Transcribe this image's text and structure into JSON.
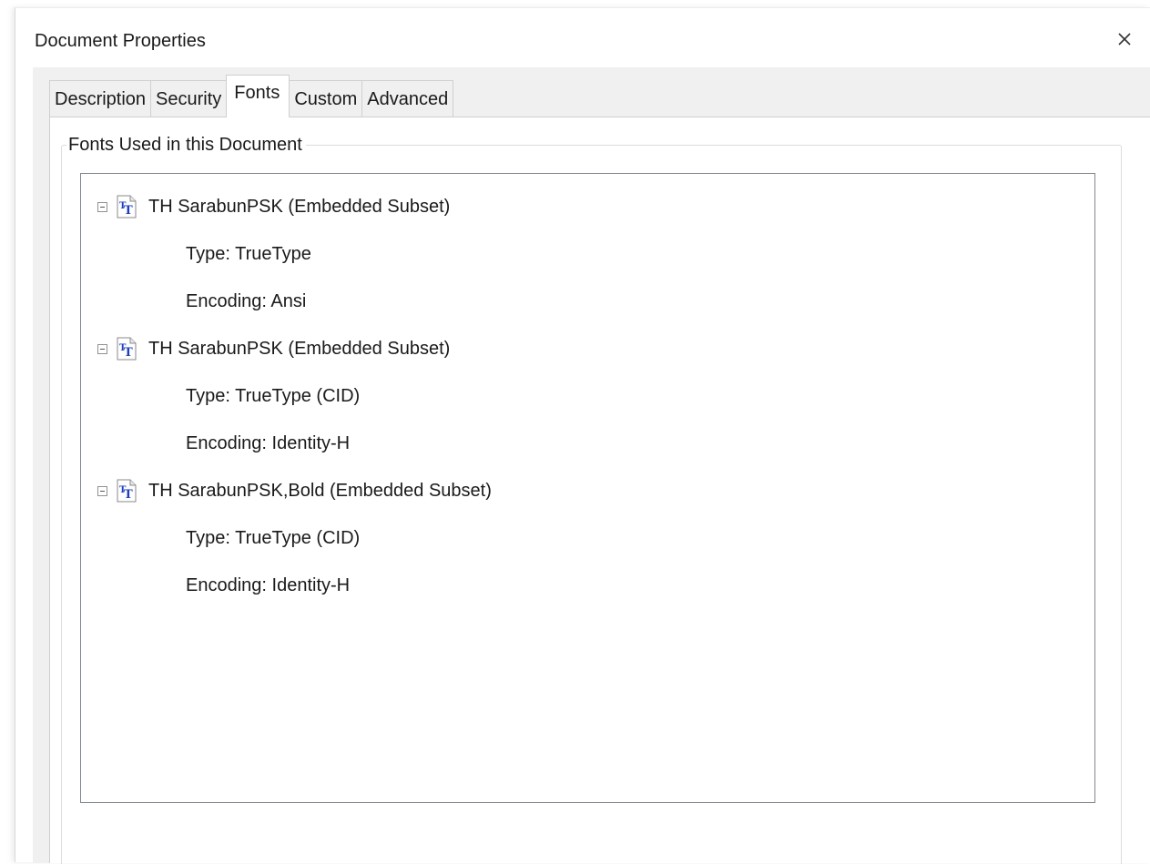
{
  "window": {
    "title": "Document Properties",
    "close_symbol": "×"
  },
  "tabs": [
    {
      "label": "Description",
      "active": false
    },
    {
      "label": "Security",
      "active": false
    },
    {
      "label": "Fonts",
      "active": true
    },
    {
      "label": "Custom",
      "active": false
    },
    {
      "label": "Advanced",
      "active": false
    }
  ],
  "fonts_group": {
    "legend": "Fonts Used in this Document",
    "fonts": [
      {
        "name": "TH SarabunPSK (Embedded Subset)",
        "type": "Type: TrueType",
        "encoding": "Encoding: Ansi",
        "icon": "truetype-font-icon",
        "expanded": true
      },
      {
        "name": "TH SarabunPSK (Embedded Subset)",
        "type": "Type: TrueType (CID)",
        "encoding": "Encoding: Identity-H",
        "icon": "truetype-font-icon",
        "expanded": true
      },
      {
        "name": "TH SarabunPSK,Bold (Embedded Subset)",
        "type": "Type: TrueType (CID)",
        "encoding": "Encoding: Identity-H",
        "icon": "truetype-font-icon",
        "expanded": true
      }
    ]
  },
  "colors": {
    "panel_background": "#f0f0f0",
    "tree_border": "#828790",
    "icon_blue": "#1f3fbf"
  }
}
